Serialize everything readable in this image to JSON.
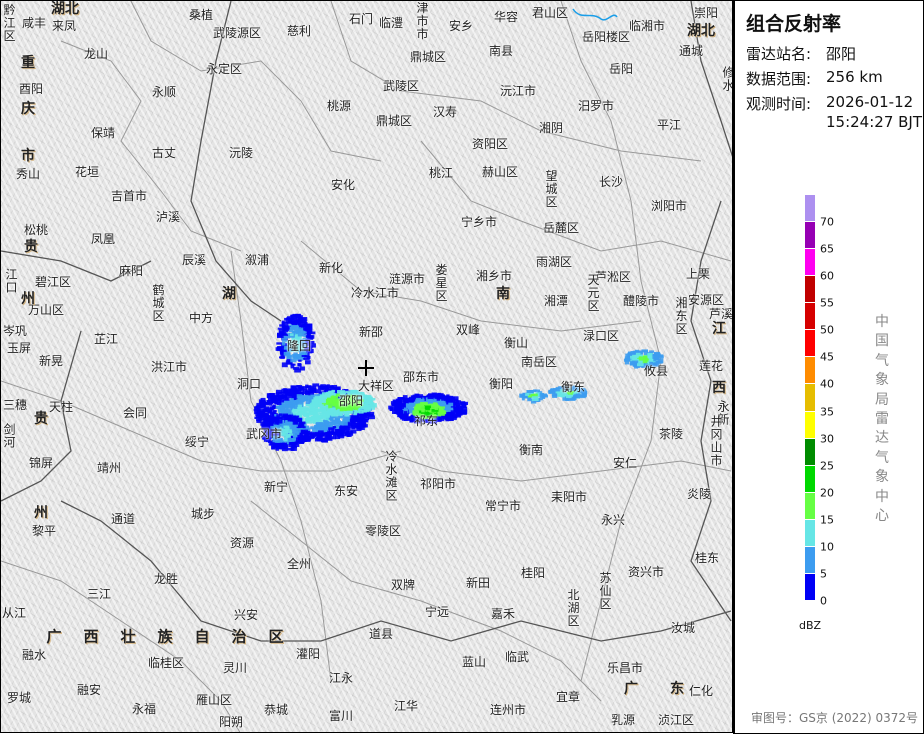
{
  "panel": {
    "title": "组合反射率",
    "station_label": "雷达站名:",
    "station_value": "邵阳",
    "range_label": "数据范围:",
    "range_value": "256 km",
    "time_label": "观测时间:",
    "time_date": "2026-01-12",
    "time_clock": "15:24:27 BJT",
    "organization": "中国气象局雷达气象中心",
    "footer": "审图号：GS京 (2022) 0372号"
  },
  "legend": {
    "unit": "dBZ",
    "ticks": [
      "0",
      "5",
      "10",
      "15",
      "20",
      "25",
      "30",
      "35",
      "40",
      "45",
      "50",
      "55",
      "60",
      "65",
      "70"
    ],
    "colors": [
      "#0000f6",
      "#3c9cf0",
      "#66e6e6",
      "#66ff44",
      "#00d800",
      "#008c00",
      "#ffff00",
      "#e6bd00",
      "#ff8c00",
      "#ff0000",
      "#d60000",
      "#c00000",
      "#ff00f0",
      "#9600b4",
      "#ad90f0"
    ]
  },
  "map": {
    "radar_site": "邵阳",
    "labels": [
      "黔江区",
      "咸丰",
      "来凤",
      "桑植",
      "武陵源区",
      "慈利",
      "石门",
      "龙山",
      "永定区",
      "酉阳",
      "永顺",
      "桃源",
      "保靖",
      "古丈",
      "沅陵",
      "秀山",
      "花垣",
      "吉首市",
      "安化",
      "泸溪",
      "松桃",
      "凤凰",
      "临澧",
      "津市市",
      "安乡",
      "华容",
      "君山区",
      "临湘市",
      "崇阳",
      "岳阳楼区",
      "南县",
      "鼎城区",
      "通城",
      "岳阳",
      "修水",
      "武陵区",
      "沅江市",
      "汨罗市",
      "汉寿",
      "鼎城区",
      "湘阴",
      "平江",
      "资阳区",
      "桃江",
      "赫山区",
      "望城区",
      "长沙",
      "浏阳市",
      "宁乡市",
      "岳麓区",
      "辰溪",
      "溆浦",
      "新化",
      "江口",
      "碧江区",
      "麻阳",
      "万山区",
      "鹤城区",
      "中方",
      "岑巩",
      "玉屏",
      "芷江",
      "隆回",
      "新晃",
      "洪江市",
      "洞口",
      "三穗",
      "天柱",
      "会同",
      "剑河",
      "绥宁",
      "武冈市",
      "锦屏",
      "靖州",
      "新宁",
      "东安",
      "涟源市",
      "娄星区",
      "湘乡市",
      "冷水江市",
      "雨湖区",
      "芦淞区",
      "天元区",
      "湘潭",
      "醴陵市",
      "湘东区",
      "上栗",
      "安源区",
      "芦溪",
      "新邵",
      "双峰",
      "衡山",
      "渌口区",
      "南岳区",
      "莲花",
      "攸县",
      "邵东市",
      "大祥区",
      "衡阳",
      "衡东",
      "邵阳",
      "祁东",
      "永新",
      "茶陵",
      "衡南",
      "井冈山市",
      "安仁",
      "冷水滩区",
      "祁阳市",
      "黎平",
      "通道",
      "城步",
      "资源",
      "全州",
      "零陵区",
      "常宁市",
      "耒阳市",
      "永兴",
      "炎陵",
      "桂东",
      "资兴市",
      "桂阳",
      "苏仙区",
      "北湖区",
      "双牌",
      "新田",
      "龙胜",
      "三江",
      "宁远",
      "嘉禾",
      "汝城",
      "从江",
      "兴安",
      "道县",
      "灌阳",
      "融水",
      "临武",
      "蓝山",
      "临桂区",
      "灵川",
      "乐昌市",
      "江永",
      "融安",
      "仁化",
      "罗城",
      "雁山区",
      "江华",
      "连州市",
      "宜章",
      "永福",
      "恭城",
      "富川",
      "阳朔",
      "乳源",
      "浈江区"
    ],
    "provinces": [
      "湖北",
      "重",
      "庆",
      "市",
      "贵",
      "湖北",
      "湖",
      "州",
      "南",
      "江",
      "西",
      "贵",
      "州",
      "广西壮族自治区",
      "广",
      "东"
    ]
  }
}
